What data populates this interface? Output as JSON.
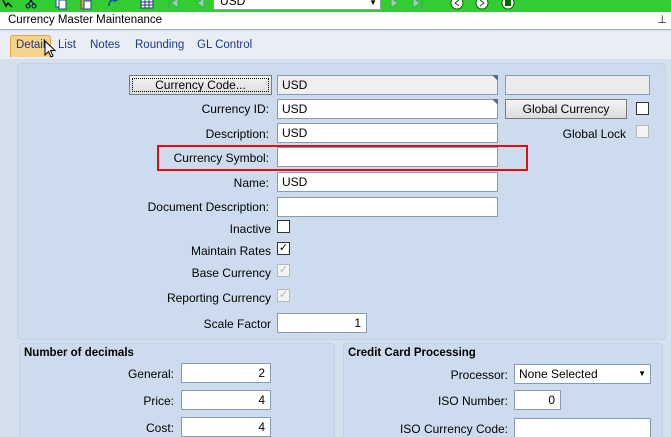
{
  "toolbar": {
    "currency_combo": "USD",
    "icons": [
      "arrow-icon",
      "cut-icon",
      "copy-icon",
      "paste-icon",
      "redo-icon",
      "grid-icon",
      "first-icon",
      "prev-icon",
      "next-icon",
      "last-icon",
      "back-circle-icon",
      "forward-circle-icon",
      "stop-icon"
    ]
  },
  "window": {
    "title": "Currency Master Maintenance",
    "pin": "⊥"
  },
  "tabs": [
    "Detail",
    "List",
    "Notes",
    "Rounding",
    "GL Control"
  ],
  "detail": {
    "currency_code_button": "Currency Code...",
    "currency_code_value": "USD",
    "currency_id_label": "Currency ID:",
    "currency_id_value": "USD",
    "global_currency_button": "Global Currency",
    "global_lock_label": "Global Lock",
    "description_label": "Description:",
    "description_value": "USD",
    "currency_symbol_label": "Currency Symbol:",
    "currency_symbol_value": "",
    "name_label": "Name:",
    "name_value": "USD",
    "document_description_label": "Document Description:",
    "document_description_value": "",
    "inactive_label": "Inactive",
    "maintain_rates_label": "Maintain Rates",
    "maintain_rates_checked": "✓",
    "base_currency_label": "Base Currency",
    "base_currency_checked": "✓",
    "reporting_currency_label": "Reporting Currency",
    "reporting_currency_checked": "✓",
    "scale_factor_label": "Scale Factor",
    "scale_factor_value": "1"
  },
  "decimals": {
    "header": "Number of decimals",
    "general_label": "General:",
    "general_value": "2",
    "price_label": "Price:",
    "price_value": "4",
    "cost_label": "Cost:",
    "cost_value": "4"
  },
  "credit_card": {
    "header": "Credit Card Processing",
    "processor_label": "Processor:",
    "processor_value": "None Selected",
    "iso_number_label": "ISO Number:",
    "iso_number_value": "0",
    "iso_currency_code_label": "ISO Currency Code:",
    "iso_currency_code_value": ""
  },
  "colors": {
    "toolbar": "#33cc33",
    "active_tab": "#f7d38a",
    "highlight": "#e01010",
    "panel": "#ccdcee"
  }
}
